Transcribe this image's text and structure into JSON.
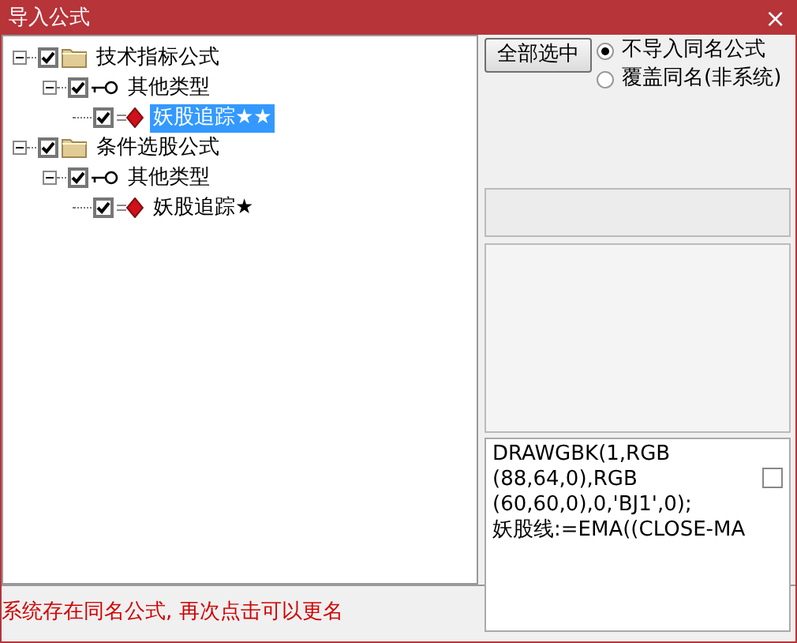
{
  "window": {
    "title": "导入公式",
    "close": "×"
  },
  "tree": [
    {
      "label": "技术指标公式",
      "kind": "folder",
      "expanded": true,
      "checked": true,
      "selected": false,
      "children": [
        {
          "label": "其他类型",
          "kind": "category",
          "expanded": true,
          "checked": true,
          "selected": false,
          "children": [
            {
              "label": "妖股追踪★★",
              "kind": "formula",
              "checked": true,
              "selected": true
            }
          ]
        }
      ]
    },
    {
      "label": "条件选股公式",
      "kind": "folder",
      "expanded": true,
      "checked": true,
      "selected": false,
      "children": [
        {
          "label": "其他类型",
          "kind": "category",
          "expanded": true,
          "checked": true,
          "selected": false,
          "children": [
            {
              "label": "妖股追踪★",
              "kind": "formula",
              "checked": true,
              "selected": false
            }
          ]
        }
      ]
    }
  ],
  "select_all_button": "全部选中",
  "radios": [
    {
      "label": "不导入同名公式",
      "selected": true
    },
    {
      "label": "覆盖同名(非系统)",
      "selected": false
    }
  ],
  "formula_text": [
    "DRAWGBK(1,RGB",
    "(88,64,0),RGB",
    "(60,60,0),0,'BJ1',0);",
    "妖股线:=EMA((CLOSE-MA"
  ],
  "formula_checkbox": {
    "checked": false
  },
  "status_bar": "系统存在同名公式, 再次点击可以更名"
}
